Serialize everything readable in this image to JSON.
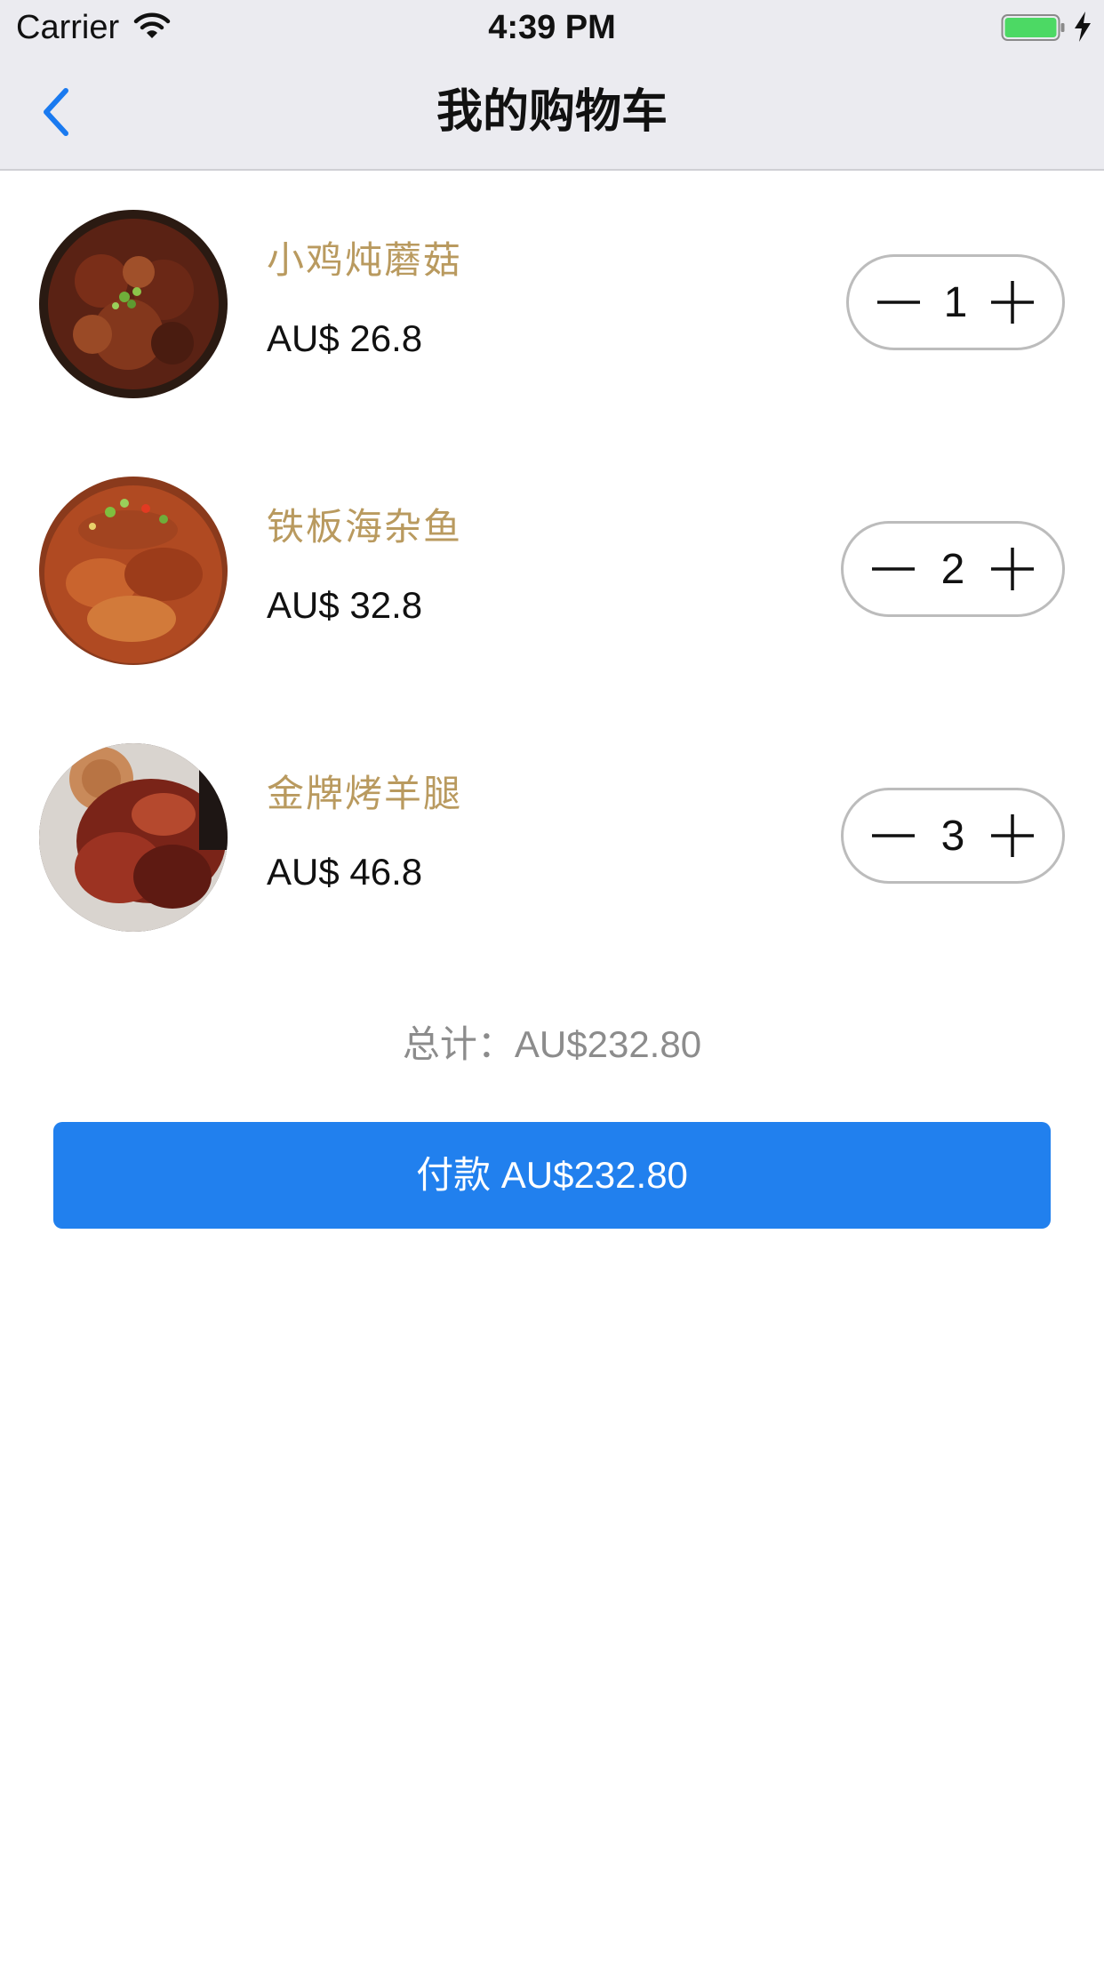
{
  "status_bar": {
    "carrier": "Carrier",
    "time": "4:39 PM",
    "battery_color": "#4cd964",
    "icons": [
      "wifi-icon",
      "battery-icon",
      "charging-bolt-icon"
    ]
  },
  "nav": {
    "title": "我的购物车",
    "back_icon": "chevron-left-icon",
    "tint_color": "#1a7af0"
  },
  "cart": {
    "items": [
      {
        "name": "小鸡炖蘑菇",
        "price": "AU$ 26.8",
        "quantity": "1"
      },
      {
        "name": "铁板海杂鱼",
        "price": "AU$ 32.8",
        "quantity": "2"
      },
      {
        "name": "金牌烤羊腿",
        "price": "AU$ 46.8",
        "quantity": "3"
      }
    ],
    "name_color": "#b99a5f"
  },
  "summary": {
    "total_label": "总计：AU$232.80",
    "pay_label": "付款 AU$232.80",
    "pay_color": "#2180ee"
  }
}
